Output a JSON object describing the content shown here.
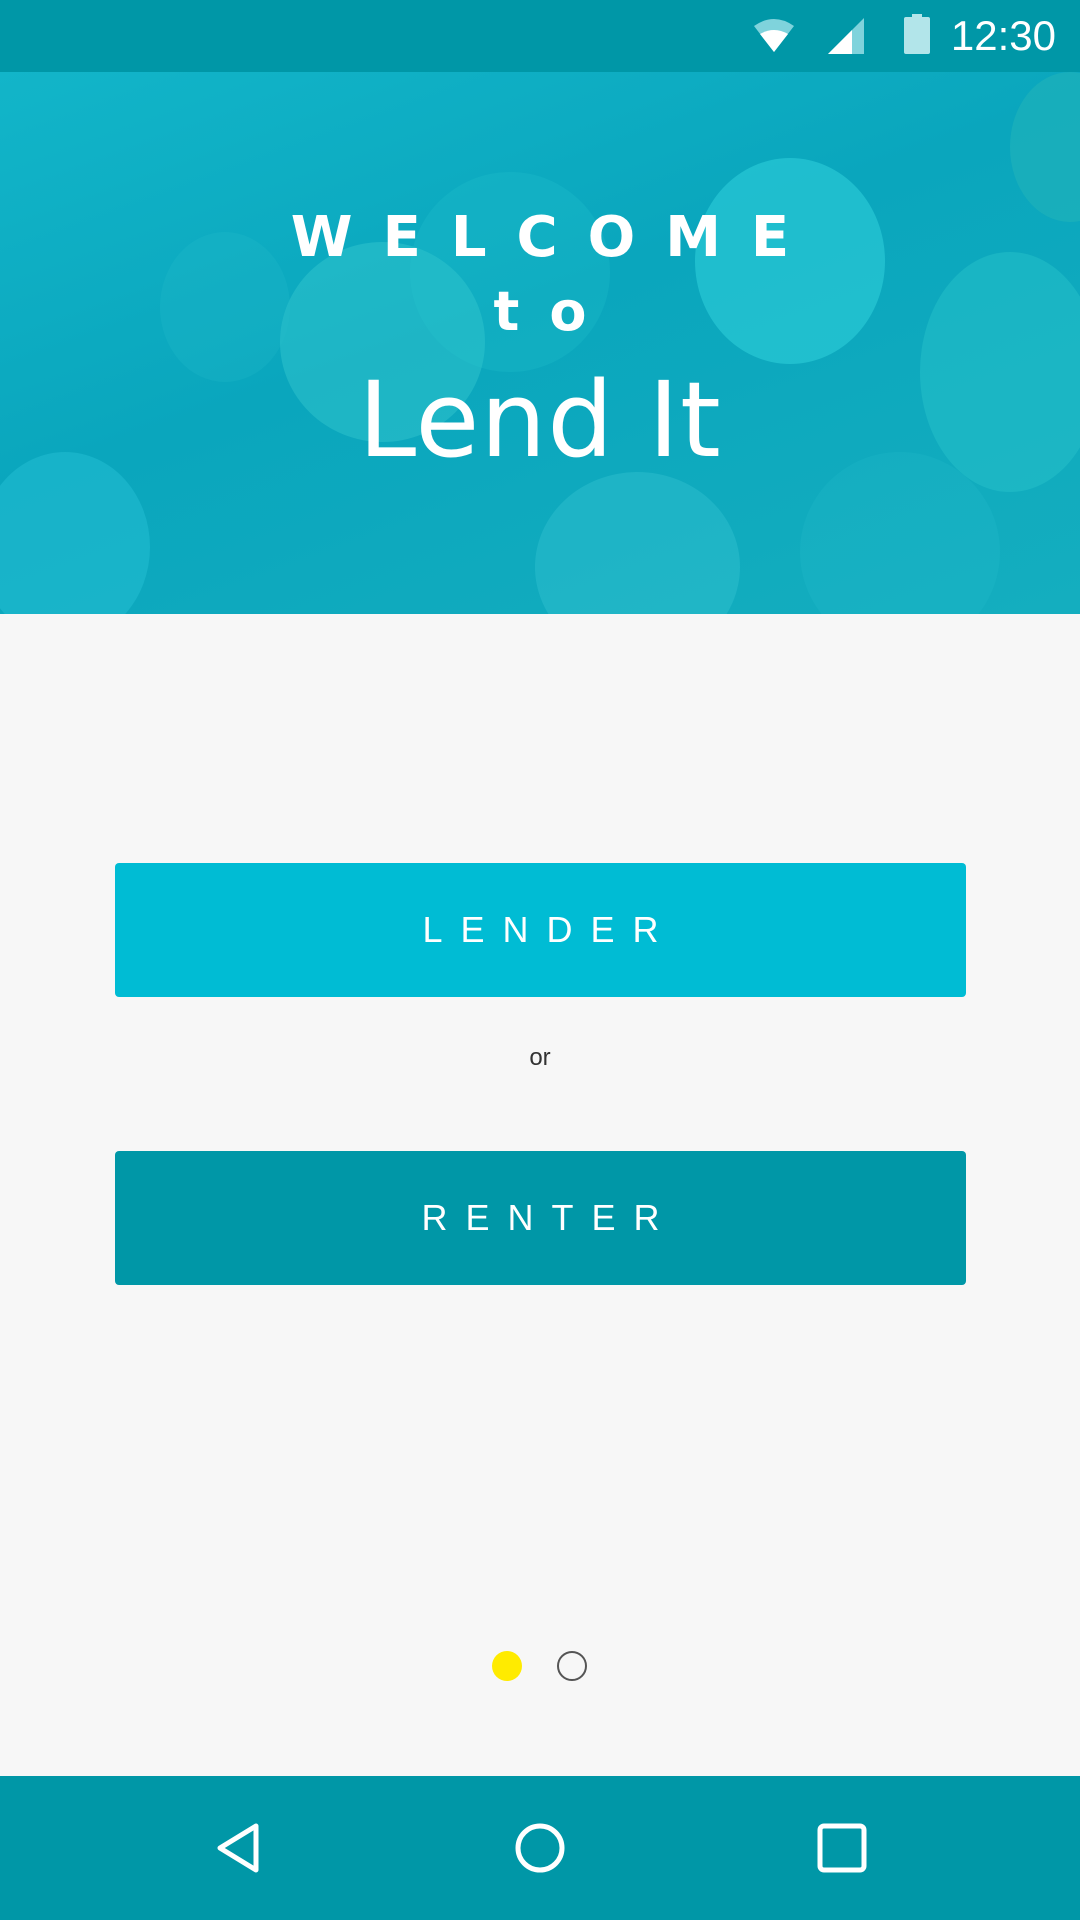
{
  "status_bar": {
    "time": "12:30",
    "icons": [
      "wifi-icon",
      "cellular-signal-icon",
      "battery-icon"
    ]
  },
  "hero": {
    "welcome": "WELCOME",
    "to": "to",
    "app_name": "Lend It"
  },
  "choices": {
    "lender_label": "LENDER",
    "separator": "or",
    "renter_label": "RENTER"
  },
  "pager": {
    "current_page": 1,
    "page_count": 2
  },
  "nav_bar": {
    "icons": [
      "back-icon",
      "home-icon",
      "recents-icon"
    ]
  },
  "colors": {
    "primary_dark": "#0097a7",
    "primary": "#00bcd4",
    "accent": "#ffeb00",
    "background": "#f7f7f7"
  }
}
